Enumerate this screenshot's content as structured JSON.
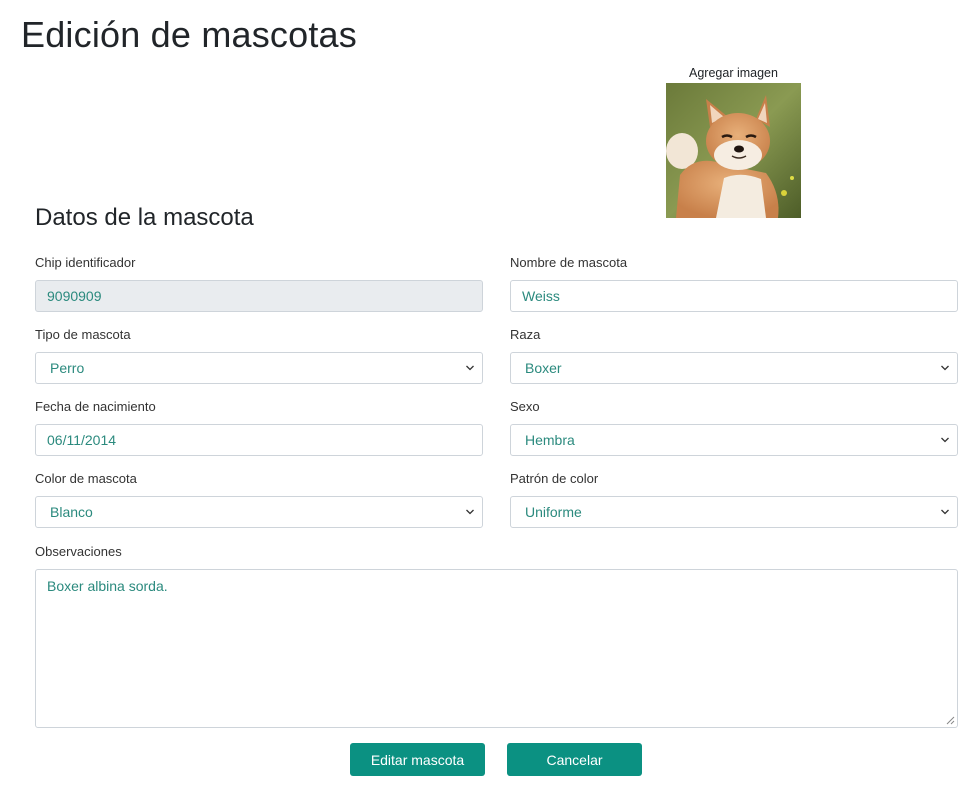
{
  "page": {
    "title": "Edición de mascotas"
  },
  "image": {
    "label": "Agregar imagen",
    "icon": "shiba-dog-photo"
  },
  "section": {
    "title": "Datos de la mascota"
  },
  "fields": {
    "chip": {
      "label": "Chip identificador",
      "value": "9090909"
    },
    "name": {
      "label": "Nombre de mascota",
      "value": "Weiss"
    },
    "type": {
      "label": "Tipo de mascota",
      "value": "Perro"
    },
    "breed": {
      "label": "Raza",
      "value": "Boxer"
    },
    "birth": {
      "label": "Fecha de nacimiento",
      "value": "06/11/2014"
    },
    "sex": {
      "label": "Sexo",
      "value": "Hembra"
    },
    "color": {
      "label": "Color de mascota",
      "value": "Blanco"
    },
    "pattern": {
      "label": "Patrón de color",
      "value": "Uniforme"
    },
    "notes": {
      "label": "Observaciones",
      "value": "Boxer albina sorda."
    }
  },
  "buttons": {
    "edit": "Editar mascota",
    "cancel": "Cancelar"
  },
  "colors": {
    "accent": "#0b9182",
    "value_text": "#2b8a7e",
    "disabled_bg": "#e9ecef",
    "border": "#ced4da"
  }
}
